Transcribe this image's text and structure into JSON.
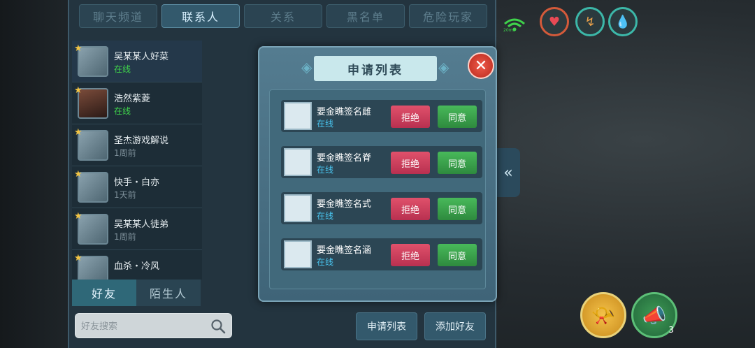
{
  "top_tabs": [
    {
      "label": "聊天频道"
    },
    {
      "label": "联系人"
    },
    {
      "label": "关系"
    },
    {
      "label": "黑名单"
    },
    {
      "label": "危险玩家"
    }
  ],
  "friends": [
    {
      "name": "吴某某人好菜",
      "status": "在线"
    },
    {
      "name": "浩然紫菱",
      "status": "在线"
    },
    {
      "name": "圣杰游戏解说",
      "status": "1周前"
    },
    {
      "name": "快手・白亦",
      "status": "1天前"
    },
    {
      "name": "吴某某人徒弟",
      "status": "1周前"
    },
    {
      "name": "血杀・冷风",
      "status": ""
    }
  ],
  "bottom_tabs": [
    {
      "label": "好友"
    },
    {
      "label": "陌生人"
    }
  ],
  "search": {
    "placeholder": "好友搜索"
  },
  "bottom_buttons": {
    "request_list": "申请列表",
    "add_friend": "添加好友"
  },
  "status_bar": {
    "network": "20ms"
  },
  "modal": {
    "title": "申请列表",
    "reject_label": "拒绝",
    "agree_label": "同意",
    "requests": [
      {
        "name": "要金瞧签名雌",
        "status": "在线"
      },
      {
        "name": "要金瞧签名脊",
        "status": "在线"
      },
      {
        "name": "要金瞧签名式",
        "status": "在线"
      },
      {
        "name": "要金瞧签名涵",
        "status": "在线"
      }
    ]
  },
  "horn_count": "3",
  "icons": [
    "wifi-icon",
    "heart-icon",
    "stamina-icon",
    "water-icon",
    "search-icon",
    "close-icon",
    "collapse-icon",
    "horn-icon"
  ]
}
